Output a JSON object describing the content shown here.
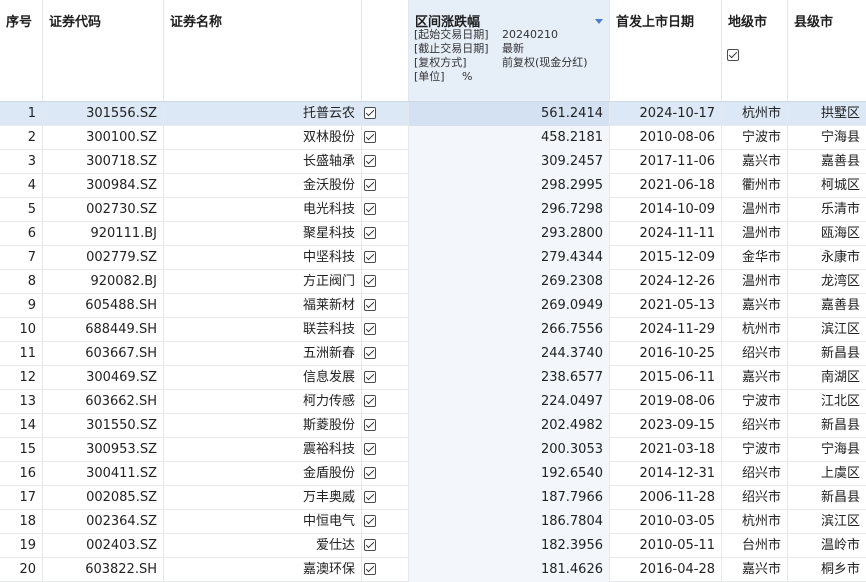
{
  "header": {
    "seq": "序号",
    "code": "证券代码",
    "name": "证券名称",
    "change": "区间涨跌幅",
    "params": [
      {
        "k": "[起始交易日期]",
        "v": "20240210"
      },
      {
        "k": "[截止交易日期]",
        "v": "最新"
      },
      {
        "k": "[复权方式]",
        "v": "前复权(现金分红)"
      },
      {
        "k": "[单位]",
        "v": "%"
      }
    ],
    "ipo_date": "首发上市日期",
    "city": "地级市",
    "county": "县级市"
  },
  "colors": {
    "accent": "#4a7fcf",
    "selected_row": "#dce8f6",
    "sorted_column_header": "#e6eef8"
  },
  "rows": [
    {
      "seq": "1",
      "code": "301556.SZ",
      "name": "托普云农",
      "change": "561.2414",
      "ipo": "2024-10-17",
      "city": "杭州市",
      "county": "拱墅区",
      "checked": true
    },
    {
      "seq": "2",
      "code": "300100.SZ",
      "name": "双林股份",
      "change": "458.2181",
      "ipo": "2010-08-06",
      "city": "宁波市",
      "county": "宁海县",
      "checked": true
    },
    {
      "seq": "3",
      "code": "300718.SZ",
      "name": "长盛轴承",
      "change": "309.2457",
      "ipo": "2017-11-06",
      "city": "嘉兴市",
      "county": "嘉善县",
      "checked": true
    },
    {
      "seq": "4",
      "code": "300984.SZ",
      "name": "金沃股份",
      "change": "298.2995",
      "ipo": "2021-06-18",
      "city": "衢州市",
      "county": "柯城区",
      "checked": true
    },
    {
      "seq": "5",
      "code": "002730.SZ",
      "name": "电光科技",
      "change": "296.7298",
      "ipo": "2014-10-09",
      "city": "温州市",
      "county": "乐清市",
      "checked": true
    },
    {
      "seq": "6",
      "code": "920111.BJ",
      "name": "聚星科技",
      "change": "293.2800",
      "ipo": "2024-11-11",
      "city": "温州市",
      "county": "瓯海区",
      "checked": true
    },
    {
      "seq": "7",
      "code": "002779.SZ",
      "name": "中坚科技",
      "change": "279.4344",
      "ipo": "2015-12-09",
      "city": "金华市",
      "county": "永康市",
      "checked": true
    },
    {
      "seq": "8",
      "code": "920082.BJ",
      "name": "方正阀门",
      "change": "269.2308",
      "ipo": "2024-12-26",
      "city": "温州市",
      "county": "龙湾区",
      "checked": true
    },
    {
      "seq": "9",
      "code": "605488.SH",
      "name": "福莱新材",
      "change": "269.0949",
      "ipo": "2021-05-13",
      "city": "嘉兴市",
      "county": "嘉善县",
      "checked": true
    },
    {
      "seq": "10",
      "code": "688449.SH",
      "name": "联芸科技",
      "change": "266.7556",
      "ipo": "2024-11-29",
      "city": "杭州市",
      "county": "滨江区",
      "checked": true
    },
    {
      "seq": "11",
      "code": "603667.SH",
      "name": "五洲新春",
      "change": "244.3740",
      "ipo": "2016-10-25",
      "city": "绍兴市",
      "county": "新昌县",
      "checked": true
    },
    {
      "seq": "12",
      "code": "300469.SZ",
      "name": "信息发展",
      "change": "238.6577",
      "ipo": "2015-06-11",
      "city": "嘉兴市",
      "county": "南湖区",
      "checked": true
    },
    {
      "seq": "13",
      "code": "603662.SH",
      "name": "柯力传感",
      "change": "224.0497",
      "ipo": "2019-08-06",
      "city": "宁波市",
      "county": "江北区",
      "checked": true
    },
    {
      "seq": "14",
      "code": "301550.SZ",
      "name": "斯菱股份",
      "change": "202.4982",
      "ipo": "2023-09-15",
      "city": "绍兴市",
      "county": "新昌县",
      "checked": true
    },
    {
      "seq": "15",
      "code": "300953.SZ",
      "name": "震裕科技",
      "change": "200.3053",
      "ipo": "2021-03-18",
      "city": "宁波市",
      "county": "宁海县",
      "checked": true
    },
    {
      "seq": "16",
      "code": "300411.SZ",
      "name": "金盾股份",
      "change": "192.6540",
      "ipo": "2014-12-31",
      "city": "绍兴市",
      "county": "上虞区",
      "checked": true
    },
    {
      "seq": "17",
      "code": "002085.SZ",
      "name": "万丰奥威",
      "change": "187.7966",
      "ipo": "2006-11-28",
      "city": "绍兴市",
      "county": "新昌县",
      "checked": true
    },
    {
      "seq": "18",
      "code": "002364.SZ",
      "name": "中恒电气",
      "change": "186.7804",
      "ipo": "2010-03-05",
      "city": "杭州市",
      "county": "滨江区",
      "checked": true
    },
    {
      "seq": "19",
      "code": "002403.SZ",
      "name": "爱仕达",
      "change": "182.3956",
      "ipo": "2010-05-11",
      "city": "台州市",
      "county": "温岭市",
      "checked": true
    },
    {
      "seq": "20",
      "code": "603822.SH",
      "name": "嘉澳环保",
      "change": "181.4626",
      "ipo": "2016-04-28",
      "city": "嘉兴市",
      "county": "桐乡市",
      "checked": true
    }
  ]
}
